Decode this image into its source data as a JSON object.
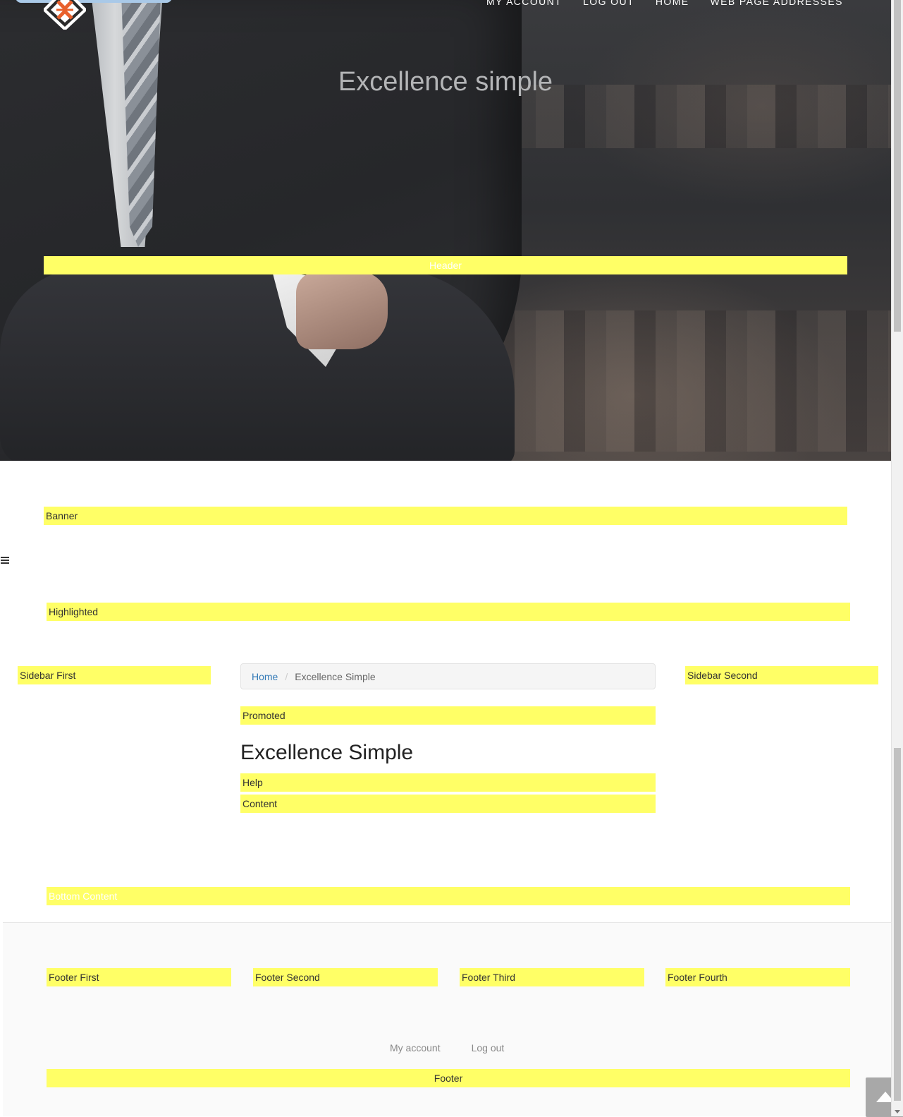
{
  "topnav": {
    "items": [
      "MY ACCOUNT",
      "LOG OUT",
      "HOME",
      "WEB PAGE ADDRESSES"
    ]
  },
  "hero": {
    "title": "Excellence simple"
  },
  "regions": {
    "header": "Header",
    "banner": "Banner",
    "highlighted": "Highlighted",
    "sidebar_first": "Sidebar First",
    "sidebar_second": "Sidebar Second",
    "promoted": "Promoted",
    "help": "Help",
    "content": "Content",
    "bottom_content": "Bottom Content",
    "footer_first": "Footer First",
    "footer_second": "Footer Second",
    "footer_third": "Footer Third",
    "footer_fourth": "Footer Fourth",
    "footer": "Footer"
  },
  "breadcrumb": {
    "home": "Home",
    "separator": "/",
    "current": "Excellence Simple"
  },
  "page": {
    "title": "Excellence Simple"
  },
  "footer_menu": {
    "items": [
      "My account",
      "Log out"
    ]
  },
  "colors": {
    "region_highlight": "#ffff66",
    "link": "#337ab7",
    "logo_orange": "#e8602c"
  },
  "icons": {
    "logo": "diamond-logo-icon",
    "back_to_top": "chevron-up-icon",
    "sidebar_toggle": "hamburger-icon"
  }
}
